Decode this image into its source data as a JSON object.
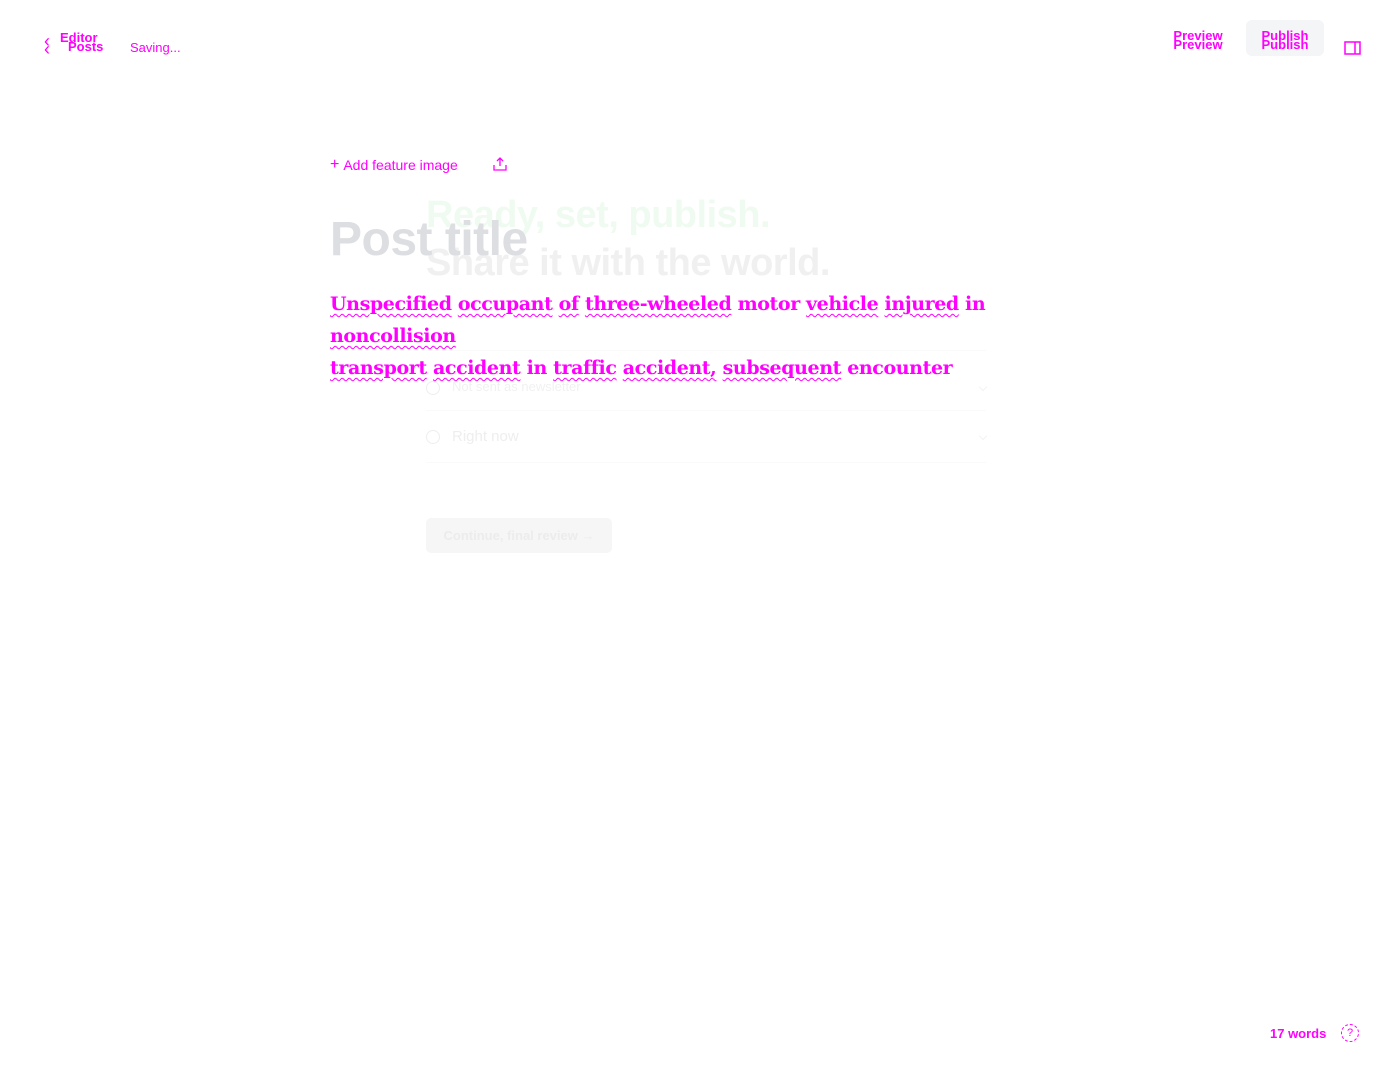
{
  "topbar": {
    "back_label_top": "Editor",
    "back_label_bottom": "Posts",
    "status": "Saving...",
    "preview_label": "Preview",
    "publish_label": "Publish"
  },
  "editor": {
    "feature_image_label": "Add feature image",
    "title_placeholder": "Post title",
    "body_words_line1": [
      "Unspecified",
      "occupant",
      "of",
      "three-wheeled",
      "motor",
      "vehicle",
      "injured",
      "in",
      "noncollision"
    ],
    "body_words_line2": [
      "transport",
      "accident",
      "in",
      "traffic",
      "accident,",
      "subsequent",
      "encounter"
    ]
  },
  "publish_overlay": {
    "heading_line1": "Ready, set, publish.",
    "heading_line2": "Share it with the world.",
    "row_audience": "Not sent as newsletter",
    "row_time": "Right now",
    "continue_label": "Continue, final review →"
  },
  "footer": {
    "word_count": "17 words",
    "help_icon": "help-icon"
  },
  "colors": {
    "accent": "#ff00ff",
    "title_placeholder": "#dcdee1",
    "publish_button_bg": "#f4f5f6"
  }
}
